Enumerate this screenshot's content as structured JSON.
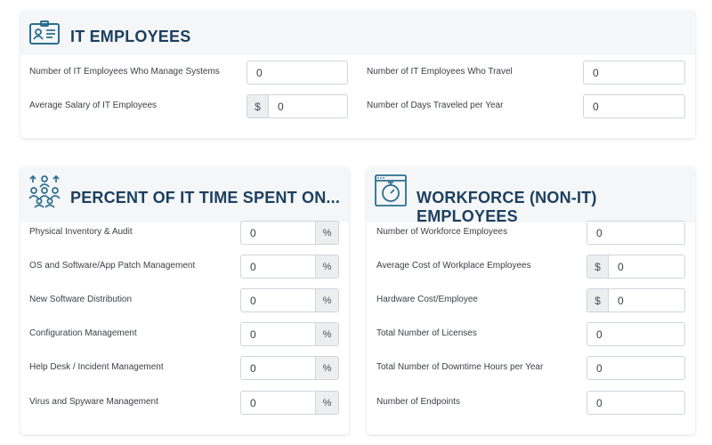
{
  "it_employees": {
    "title": "IT EMPLOYEES",
    "icon": "id-badge-icon",
    "fields": [
      {
        "label": "Number of IT Employees Who Manage Systems",
        "value": "0"
      },
      {
        "label": "Average Salary of IT Employees",
        "prefix": "$",
        "value": "0"
      },
      {
        "label": "Number of IT Employees Who Travel",
        "value": "0"
      },
      {
        "label": "Number of Days Traveled per Year",
        "value": "0"
      }
    ]
  },
  "percent_time": {
    "title": "PERCENT OF IT TIME SPENT ON...",
    "icon": "group-people-icon",
    "suffix": "%",
    "fields": [
      {
        "label": "Physical Inventory & Audit",
        "value": "0"
      },
      {
        "label": "OS and Software/App Patch Management",
        "value": "0"
      },
      {
        "label": "New Software Distribution",
        "value": "0"
      },
      {
        "label": "Configuration Management",
        "value": "0"
      },
      {
        "label": "Help Desk / Incident Management",
        "value": "0"
      },
      {
        "label": "Virus and Spyware Management",
        "value": "0"
      }
    ]
  },
  "workforce": {
    "title": "WORKFORCE (NON-IT) EMPLOYEES",
    "icon": "stopwatch-window-icon",
    "fields": [
      {
        "label": "Number of Workforce Employees",
        "value": "0"
      },
      {
        "label": "Average Cost of Workplace Employees",
        "prefix": "$",
        "value": "0"
      },
      {
        "label": "Hardware Cost/Employee",
        "prefix": "$",
        "value": "0"
      },
      {
        "label": "Total Number of Licenses",
        "value": "0"
      },
      {
        "label": "Total Number of Downtime Hours per Year",
        "value": "0"
      },
      {
        "label": "Number of Endpoints",
        "value": "0"
      }
    ]
  },
  "colors": {
    "title": "#1c3f5e",
    "icon": "#2b6f8e",
    "header_bg": "#f4f6f8",
    "addon_bg": "#eceef0",
    "border": "#cfd5db"
  }
}
